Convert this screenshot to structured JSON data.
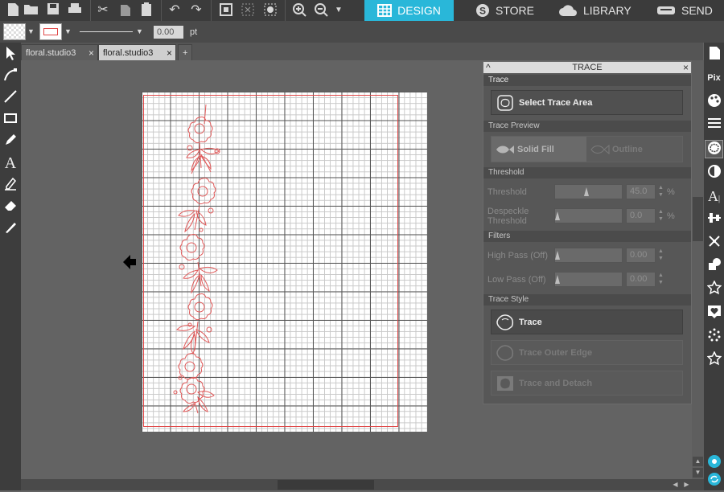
{
  "top_tabs": [
    {
      "label": "DESIGN",
      "icon": "grid-icon",
      "active": true
    },
    {
      "label": "STORE",
      "icon": "store-s-icon",
      "active": false
    },
    {
      "label": "LIBRARY",
      "icon": "cloud-icon",
      "active": false
    },
    {
      "label": "SEND",
      "icon": "cutter-icon",
      "active": false
    }
  ],
  "toolbar2": {
    "line_width": "0.00",
    "unit": "pt"
  },
  "doc_tabs": [
    {
      "label": "floral.studio3",
      "active": false
    },
    {
      "label": "floral.studio3",
      "active": true
    }
  ],
  "add_tab_label": "+",
  "trace_panel": {
    "title": "TRACE",
    "sections": {
      "trace": "Trace",
      "preview": "Trace Preview",
      "threshold": "Threshold",
      "filters": "Filters",
      "style": "Trace Style"
    },
    "select_trace_area": "Select Trace Area",
    "solid_fill": "Solid Fill",
    "outline": "Outline",
    "threshold_label": "Threshold",
    "threshold_value": "45.0",
    "threshold_level": 0.45,
    "despeckle_label_1": "Despeckle",
    "despeckle_label_2": "Threshold",
    "despeckle_value": "0.0",
    "high_pass_label": "High Pass (Off)",
    "high_pass_value": "0.00",
    "low_pass_label": "Low Pass (Off)",
    "low_pass_value": "0.00",
    "percent": "%",
    "trace_btn": "Trace",
    "trace_outer_edge_btn": "Trace Outer Edge",
    "trace_detach_btn": "Trace and Detach"
  },
  "colors": {
    "active_tab": "#29b7d9",
    "cut_line": "#e04848"
  }
}
